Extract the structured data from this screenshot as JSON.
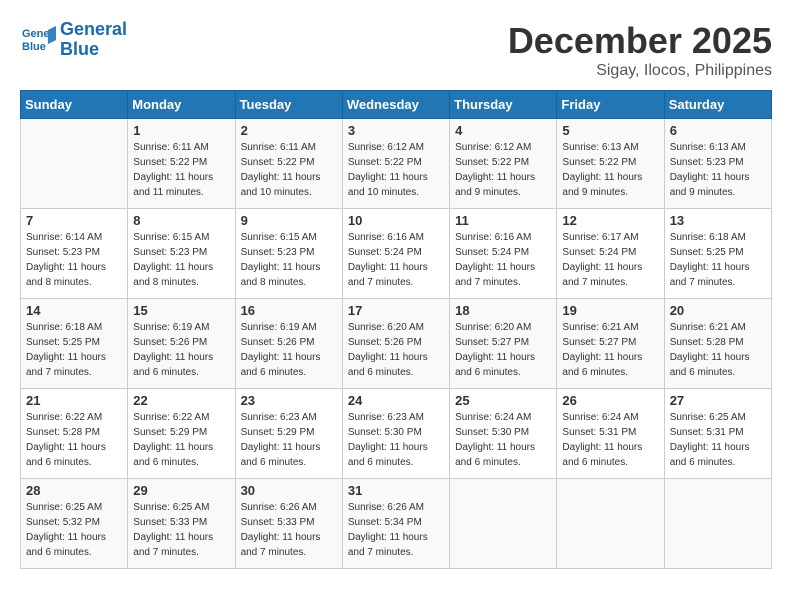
{
  "header": {
    "logo_line1": "General",
    "logo_line2": "Blue",
    "month": "December 2025",
    "location": "Sigay, Ilocos, Philippines"
  },
  "weekdays": [
    "Sunday",
    "Monday",
    "Tuesday",
    "Wednesday",
    "Thursday",
    "Friday",
    "Saturday"
  ],
  "weeks": [
    [
      {
        "day": "",
        "sunrise": "",
        "sunset": "",
        "daylight": ""
      },
      {
        "day": "1",
        "sunrise": "Sunrise: 6:11 AM",
        "sunset": "Sunset: 5:22 PM",
        "daylight": "Daylight: 11 hours and 11 minutes."
      },
      {
        "day": "2",
        "sunrise": "Sunrise: 6:11 AM",
        "sunset": "Sunset: 5:22 PM",
        "daylight": "Daylight: 11 hours and 10 minutes."
      },
      {
        "day": "3",
        "sunrise": "Sunrise: 6:12 AM",
        "sunset": "Sunset: 5:22 PM",
        "daylight": "Daylight: 11 hours and 10 minutes."
      },
      {
        "day": "4",
        "sunrise": "Sunrise: 6:12 AM",
        "sunset": "Sunset: 5:22 PM",
        "daylight": "Daylight: 11 hours and 9 minutes."
      },
      {
        "day": "5",
        "sunrise": "Sunrise: 6:13 AM",
        "sunset": "Sunset: 5:22 PM",
        "daylight": "Daylight: 11 hours and 9 minutes."
      },
      {
        "day": "6",
        "sunrise": "Sunrise: 6:13 AM",
        "sunset": "Sunset: 5:23 PM",
        "daylight": "Daylight: 11 hours and 9 minutes."
      }
    ],
    [
      {
        "day": "7",
        "sunrise": "Sunrise: 6:14 AM",
        "sunset": "Sunset: 5:23 PM",
        "daylight": "Daylight: 11 hours and 8 minutes."
      },
      {
        "day": "8",
        "sunrise": "Sunrise: 6:15 AM",
        "sunset": "Sunset: 5:23 PM",
        "daylight": "Daylight: 11 hours and 8 minutes."
      },
      {
        "day": "9",
        "sunrise": "Sunrise: 6:15 AM",
        "sunset": "Sunset: 5:23 PM",
        "daylight": "Daylight: 11 hours and 8 minutes."
      },
      {
        "day": "10",
        "sunrise": "Sunrise: 6:16 AM",
        "sunset": "Sunset: 5:24 PM",
        "daylight": "Daylight: 11 hours and 7 minutes."
      },
      {
        "day": "11",
        "sunrise": "Sunrise: 6:16 AM",
        "sunset": "Sunset: 5:24 PM",
        "daylight": "Daylight: 11 hours and 7 minutes."
      },
      {
        "day": "12",
        "sunrise": "Sunrise: 6:17 AM",
        "sunset": "Sunset: 5:24 PM",
        "daylight": "Daylight: 11 hours and 7 minutes."
      },
      {
        "day": "13",
        "sunrise": "Sunrise: 6:18 AM",
        "sunset": "Sunset: 5:25 PM",
        "daylight": "Daylight: 11 hours and 7 minutes."
      }
    ],
    [
      {
        "day": "14",
        "sunrise": "Sunrise: 6:18 AM",
        "sunset": "Sunset: 5:25 PM",
        "daylight": "Daylight: 11 hours and 7 minutes."
      },
      {
        "day": "15",
        "sunrise": "Sunrise: 6:19 AM",
        "sunset": "Sunset: 5:26 PM",
        "daylight": "Daylight: 11 hours and 6 minutes."
      },
      {
        "day": "16",
        "sunrise": "Sunrise: 6:19 AM",
        "sunset": "Sunset: 5:26 PM",
        "daylight": "Daylight: 11 hours and 6 minutes."
      },
      {
        "day": "17",
        "sunrise": "Sunrise: 6:20 AM",
        "sunset": "Sunset: 5:26 PM",
        "daylight": "Daylight: 11 hours and 6 minutes."
      },
      {
        "day": "18",
        "sunrise": "Sunrise: 6:20 AM",
        "sunset": "Sunset: 5:27 PM",
        "daylight": "Daylight: 11 hours and 6 minutes."
      },
      {
        "day": "19",
        "sunrise": "Sunrise: 6:21 AM",
        "sunset": "Sunset: 5:27 PM",
        "daylight": "Daylight: 11 hours and 6 minutes."
      },
      {
        "day": "20",
        "sunrise": "Sunrise: 6:21 AM",
        "sunset": "Sunset: 5:28 PM",
        "daylight": "Daylight: 11 hours and 6 minutes."
      }
    ],
    [
      {
        "day": "21",
        "sunrise": "Sunrise: 6:22 AM",
        "sunset": "Sunset: 5:28 PM",
        "daylight": "Daylight: 11 hours and 6 minutes."
      },
      {
        "day": "22",
        "sunrise": "Sunrise: 6:22 AM",
        "sunset": "Sunset: 5:29 PM",
        "daylight": "Daylight: 11 hours and 6 minutes."
      },
      {
        "day": "23",
        "sunrise": "Sunrise: 6:23 AM",
        "sunset": "Sunset: 5:29 PM",
        "daylight": "Daylight: 11 hours and 6 minutes."
      },
      {
        "day": "24",
        "sunrise": "Sunrise: 6:23 AM",
        "sunset": "Sunset: 5:30 PM",
        "daylight": "Daylight: 11 hours and 6 minutes."
      },
      {
        "day": "25",
        "sunrise": "Sunrise: 6:24 AM",
        "sunset": "Sunset: 5:30 PM",
        "daylight": "Daylight: 11 hours and 6 minutes."
      },
      {
        "day": "26",
        "sunrise": "Sunrise: 6:24 AM",
        "sunset": "Sunset: 5:31 PM",
        "daylight": "Daylight: 11 hours and 6 minutes."
      },
      {
        "day": "27",
        "sunrise": "Sunrise: 6:25 AM",
        "sunset": "Sunset: 5:31 PM",
        "daylight": "Daylight: 11 hours and 6 minutes."
      }
    ],
    [
      {
        "day": "28",
        "sunrise": "Sunrise: 6:25 AM",
        "sunset": "Sunset: 5:32 PM",
        "daylight": "Daylight: 11 hours and 6 minutes."
      },
      {
        "day": "29",
        "sunrise": "Sunrise: 6:25 AM",
        "sunset": "Sunset: 5:33 PM",
        "daylight": "Daylight: 11 hours and 7 minutes."
      },
      {
        "day": "30",
        "sunrise": "Sunrise: 6:26 AM",
        "sunset": "Sunset: 5:33 PM",
        "daylight": "Daylight: 11 hours and 7 minutes."
      },
      {
        "day": "31",
        "sunrise": "Sunrise: 6:26 AM",
        "sunset": "Sunset: 5:34 PM",
        "daylight": "Daylight: 11 hours and 7 minutes."
      },
      {
        "day": "",
        "sunrise": "",
        "sunset": "",
        "daylight": ""
      },
      {
        "day": "",
        "sunrise": "",
        "sunset": "",
        "daylight": ""
      },
      {
        "day": "",
        "sunrise": "",
        "sunset": "",
        "daylight": ""
      }
    ]
  ]
}
